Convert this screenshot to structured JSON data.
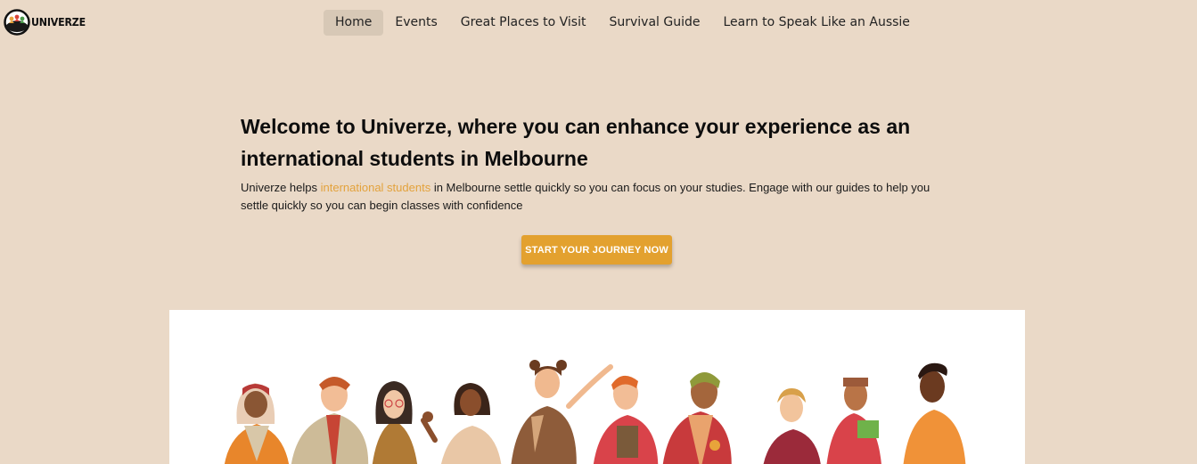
{
  "brand": {
    "name": "UNIVERZE",
    "logo_icon": "people-circle-logo-icon"
  },
  "nav": {
    "items": [
      {
        "label": "Home",
        "active": true
      },
      {
        "label": "Events",
        "active": false
      },
      {
        "label": "Great Places to Visit",
        "active": false
      },
      {
        "label": "Survival Guide",
        "active": false
      },
      {
        "label": "Learn to Speak Like an Aussie",
        "active": false
      }
    ]
  },
  "hero": {
    "title": "Welcome to Univerze, where you can enhance your experience as an international students in Melbourne",
    "desc_before": "Univerze helps ",
    "desc_highlight": "international students",
    "desc_after": " in Melbourne settle quickly so you can focus on your studies. Engage with our guides to help you settle quickly so you can begin classes with confidence",
    "cta_label": "START YOUR JOURNEY NOW"
  },
  "colors": {
    "page_background": "#ead9c7",
    "active_nav": "#d7c8b6",
    "accent": "#e3a23c",
    "cta": "#e3a12f"
  },
  "illustration": {
    "icon": "diverse-students-group-illustration"
  }
}
